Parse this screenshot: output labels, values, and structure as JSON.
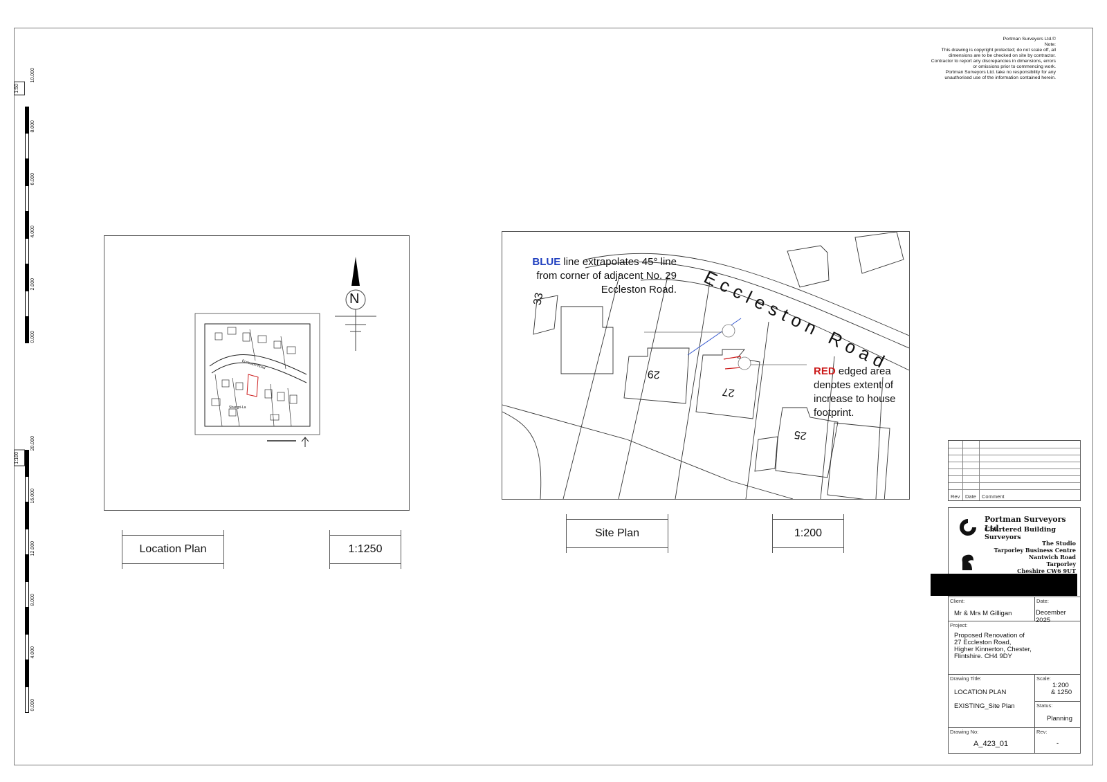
{
  "note": {
    "lines": [
      "Portman Surveyors Ltd.©",
      "Note:",
      "This drawing is copyright protected; do not scale off, all",
      "dimensions are to be checked on site by contractor.",
      "Contractor to report any discrepancies in dimensions, errors",
      "or omissions prior to commencing work.",
      "Portman Surveyors Ltd. take no responsibility for any",
      "unauthorised use of the information contained herein."
    ]
  },
  "scalebar_top": {
    "label": "1:50",
    "ticks": [
      "10.000",
      "8.000",
      "6.000",
      "4.000",
      "2.000",
      "0.000"
    ]
  },
  "scalebar_bottom": {
    "label": "1:100",
    "ticks": [
      "20.000",
      "16.000",
      "12.000",
      "8.000",
      "4.000",
      "0.000"
    ]
  },
  "location_plan": {
    "north_letter": "N",
    "map_label": "Shangri-La",
    "road_label": "Eccleston Road"
  },
  "labels": {
    "location_plan": "Location Plan",
    "location_scale": "1:1250",
    "site_plan": "Site Plan",
    "site_scale": "1:200"
  },
  "site_plan": {
    "road": "Eccleston Road",
    "blue_word": "BLUE",
    "blue_line1": " line extrapolates 45° line",
    "blue_line2": "from corner of adjacent No. 29",
    "blue_line3": "Eccleston Road.",
    "red_word": "RED",
    "red_line1": " edged area",
    "red_line2": "denotes extent of",
    "red_line3": "increase to house",
    "red_line4": "footprint.",
    "house_33": "33",
    "house_29": "29",
    "house_27": "27",
    "house_25": "25"
  },
  "revision_table": {
    "rev": "Rev",
    "date": "Date",
    "comment": "Comment"
  },
  "company": {
    "name": "Portman Surveyors Ltd",
    "subtitle": "Chartered Building Surveyors",
    "address": [
      "The Studio",
      "Tarporley Business Centre",
      "Nantwich Road",
      "Tarporley",
      "Cheshire  CW6 9UT"
    ]
  },
  "titleblock": {
    "client_cap": "Client:",
    "client": "Mr & Mrs M Gilligan",
    "date_cap": "Date:",
    "date": "December 2025",
    "project_cap": "Project:",
    "project": [
      "Proposed Renovation of",
      "27 Eccleston Road,",
      "Higher Kinnerton, Chester,",
      "Flintshire.  CH4 9DY"
    ],
    "drawing_title_cap": "Drawing Title:",
    "drawing_title_1": "LOCATION PLAN",
    "drawing_title_2": "EXISTING_Site Plan",
    "scale_cap": "Scale:",
    "scale_1": "1:200",
    "scale_2": "& 1250",
    "status_cap": "Status:",
    "status": "Planning",
    "drawing_no_cap": "Drawing No:",
    "drawing_no": "A_423_01",
    "rev_cap": "Rev:",
    "rev": "-"
  },
  "colors": {
    "blue_annotation": "#1f3fbf",
    "red_annotation": "#cc1a1a",
    "linework": "#555555"
  }
}
